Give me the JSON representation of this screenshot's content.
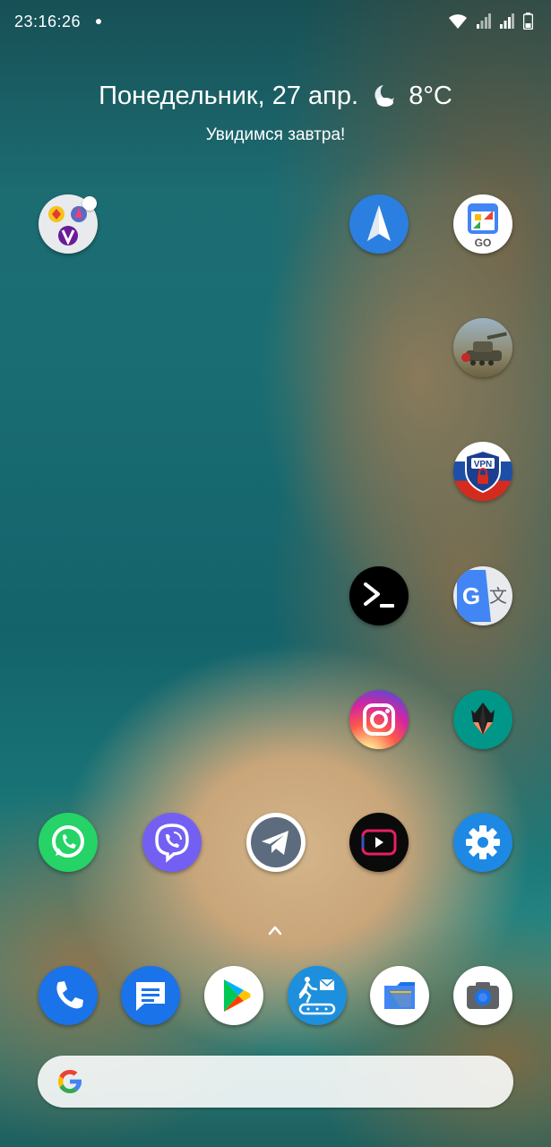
{
  "status_bar": {
    "time": "23:16:26",
    "icons": [
      "notification-dot-icon",
      "wifi-icon",
      "signal-1-icon",
      "signal-2-icon",
      "battery-icon"
    ]
  },
  "glance": {
    "date": "Понедельник, 27 апр.",
    "weather_icon": "moon-cloud-icon",
    "temperature": "8°C",
    "subtitle": "Увидимся завтра!"
  },
  "home_apps": [
    {
      "name": "app-folder",
      "icon": "folder-icon"
    },
    {
      "name": "spark-mail",
      "icon": "paper-plane-icon"
    },
    {
      "name": "google-calendar-go",
      "icon": "calendar-go-icon",
      "label": "GO"
    },
    {
      "name": "world-of-tanks",
      "icon": "tank-icon"
    },
    {
      "name": "vpn-russia",
      "icon": "vpn-shield-icon",
      "label": "VPN"
    },
    {
      "name": "terminal",
      "icon": "terminal-prompt-icon"
    },
    {
      "name": "google-translate",
      "icon": "translate-icon",
      "label": "G"
    },
    {
      "name": "instagram",
      "icon": "instagram-icon"
    },
    {
      "name": "magisk",
      "icon": "magisk-icon"
    },
    {
      "name": "whatsapp",
      "icon": "whatsapp-icon"
    },
    {
      "name": "viber",
      "icon": "viber-icon"
    },
    {
      "name": "telegram",
      "icon": "telegram-icon"
    },
    {
      "name": "youtube-vanced",
      "icon": "play-screen-icon"
    },
    {
      "name": "settings",
      "icon": "gear-icon"
    }
  ],
  "dock": {
    "handle_icon": "chevron-up-icon",
    "apps": [
      {
        "name": "phone",
        "icon": "phone-icon"
      },
      {
        "name": "messages",
        "icon": "message-icon"
      },
      {
        "name": "play-store",
        "icon": "play-store-icon"
      },
      {
        "name": "fitness-mail",
        "icon": "runner-mail-icon"
      },
      {
        "name": "files",
        "icon": "files-icon"
      },
      {
        "name": "camera",
        "icon": "camera-icon"
      }
    ]
  },
  "search": {
    "icon": "google-g-icon"
  },
  "colors": {
    "sea": "#1a6e73",
    "sand": "#d4b58a",
    "whatsapp": "#25d366",
    "viber": "#7360f2",
    "settings": "#1e88e5",
    "phone": "#1a73e8"
  }
}
